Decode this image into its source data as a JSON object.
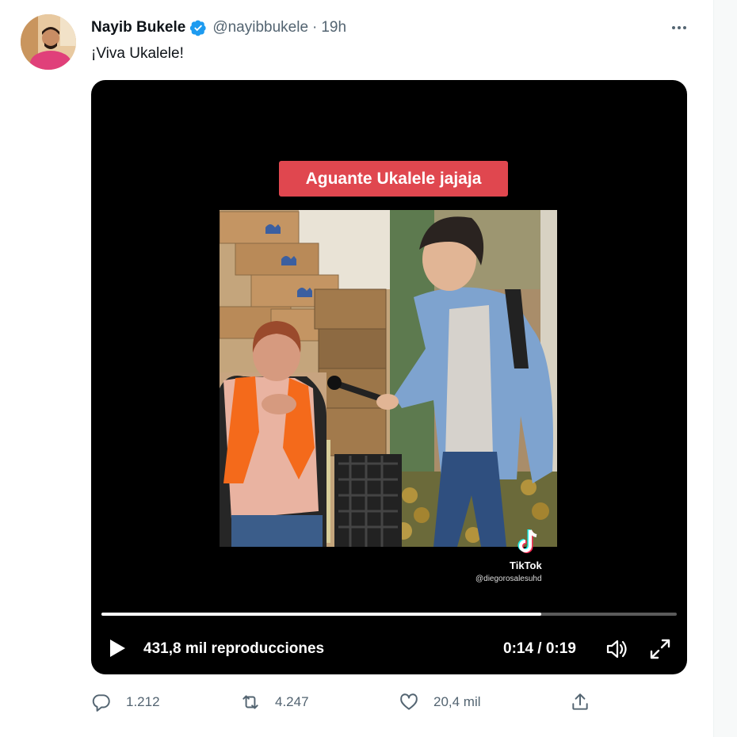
{
  "author": {
    "name": "Nayib Bukele",
    "handle": "@nayibbukele",
    "separator": "·",
    "time": "19h"
  },
  "tweet": {
    "text": "¡Viva Ukalele!"
  },
  "video": {
    "caption": "Aguante Ukalele jajaja",
    "watermark_label": "TikTok",
    "watermark_user": "@diegorosalesuhd",
    "views": "431,8 mil reproducciones",
    "time_display": "0:14 / 0:19",
    "progress_fraction": 0.764
  },
  "actions": {
    "replies": "1.212",
    "retweets": "4.247",
    "likes": "20,4 mil"
  },
  "colors": {
    "verified": "#1d9bf0",
    "caption_bg": "#e0474f",
    "muted_text": "#536471"
  },
  "icons": [
    "verified-badge-icon",
    "more-options-icon",
    "play-icon",
    "volume-icon",
    "fullscreen-icon",
    "tiktok-logo-icon",
    "reply-icon",
    "retweet-icon",
    "like-icon",
    "share-icon"
  ]
}
